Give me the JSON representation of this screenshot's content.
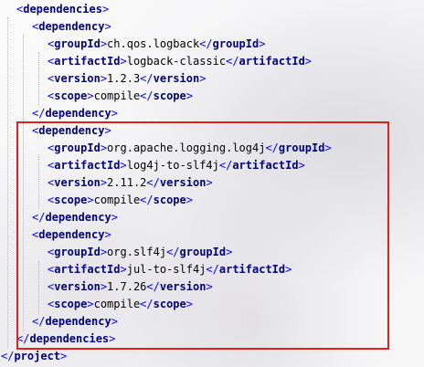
{
  "editor": {
    "lines": [
      {
        "indent": 1,
        "kind": "open",
        "tag": "dependencies"
      },
      {
        "indent": 2,
        "kind": "open",
        "tag": "dependency"
      },
      {
        "indent": 3,
        "kind": "elem",
        "tag": "groupId",
        "value": "ch.qos.logback"
      },
      {
        "indent": 3,
        "kind": "elem",
        "tag": "artifactId",
        "value": "logback-classic"
      },
      {
        "indent": 3,
        "kind": "elem",
        "tag": "version",
        "value": "1.2.3"
      },
      {
        "indent": 3,
        "kind": "elem",
        "tag": "scope",
        "value": "compile"
      },
      {
        "indent": 2,
        "kind": "close",
        "tag": "dependency"
      },
      {
        "indent": 2,
        "kind": "open",
        "tag": "dependency"
      },
      {
        "indent": 3,
        "kind": "elem",
        "tag": "groupId",
        "value": "org.apache.logging.log4j"
      },
      {
        "indent": 3,
        "kind": "elem",
        "tag": "artifactId",
        "value": "log4j-to-slf4j"
      },
      {
        "indent": 3,
        "kind": "elem",
        "tag": "version",
        "value": "2.11.2"
      },
      {
        "indent": 3,
        "kind": "elem",
        "tag": "scope",
        "value": "compile"
      },
      {
        "indent": 2,
        "kind": "close",
        "tag": "dependency"
      },
      {
        "indent": 2,
        "kind": "open",
        "tag": "dependency"
      },
      {
        "indent": 3,
        "kind": "elem",
        "tag": "groupId",
        "value": "org.slf4j"
      },
      {
        "indent": 3,
        "kind": "elem",
        "tag": "artifactId",
        "value": "jul-to-slf4j"
      },
      {
        "indent": 3,
        "kind": "elem",
        "tag": "version",
        "value": "1.7.26"
      },
      {
        "indent": 3,
        "kind": "elem",
        "tag": "scope",
        "value": "compile"
      },
      {
        "indent": 2,
        "kind": "close",
        "tag": "dependency"
      },
      {
        "indent": 1,
        "kind": "close",
        "tag": "dependencies"
      },
      {
        "indent": 0,
        "kind": "close",
        "tag": "project"
      }
    ]
  },
  "colors": {
    "bracket": "#0000ff",
    "tag": "#000080",
    "text": "#000000",
    "highlight_border": "#e0201f"
  }
}
